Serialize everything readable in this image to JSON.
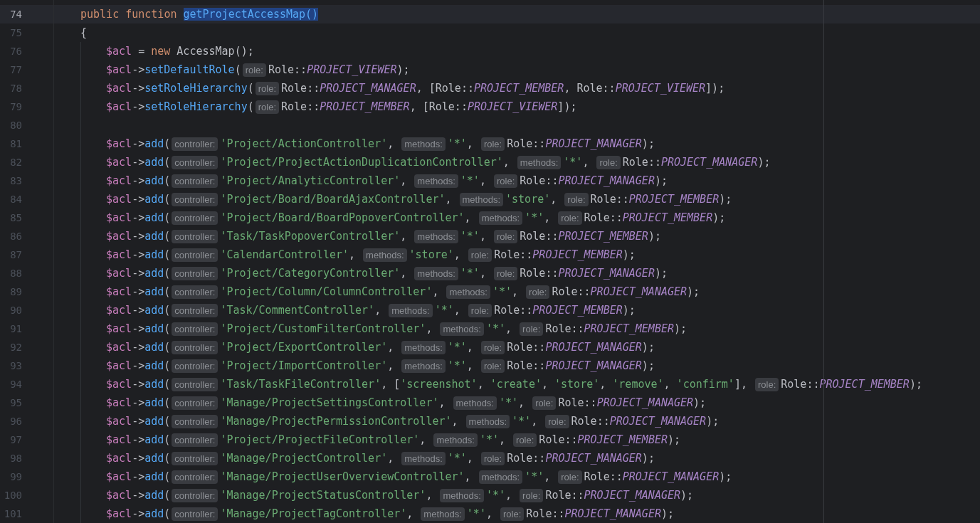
{
  "editor": {
    "lines": [
      {
        "number": "74",
        "current": true,
        "in_body": false,
        "tokens": [
          {
            "kind": "kw",
            "text": "public function "
          },
          {
            "kind": "sel",
            "text": "getProjectAccessMap()"
          }
        ]
      },
      {
        "number": "75",
        "current": false,
        "in_body": false,
        "tokens": [
          {
            "kind": "plain",
            "text": "{"
          }
        ]
      },
      {
        "number": "76",
        "current": false,
        "in_body": true,
        "tokens": [
          {
            "kind": "var",
            "text": "$acl"
          },
          {
            "kind": "plain",
            "text": " = "
          },
          {
            "kind": "kw",
            "text": "new "
          },
          {
            "kind": "cls",
            "text": "AccessMap"
          },
          {
            "kind": "plain",
            "text": "();"
          }
        ]
      },
      {
        "number": "77",
        "current": false,
        "in_body": true,
        "tokens": [
          {
            "kind": "var",
            "text": "$acl"
          },
          {
            "kind": "plain",
            "text": "->"
          },
          {
            "kind": "fn",
            "text": "setDefaultRole"
          },
          {
            "kind": "plain",
            "text": "("
          },
          {
            "kind": "hint",
            "text": "role:"
          },
          {
            "kind": "cls",
            "text": "Role"
          },
          {
            "kind": "plain",
            "text": "::"
          },
          {
            "kind": "const",
            "text": "PROJECT_VIEWER"
          },
          {
            "kind": "plain",
            "text": ");"
          }
        ]
      },
      {
        "number": "78",
        "current": false,
        "in_body": true,
        "tokens": [
          {
            "kind": "var",
            "text": "$acl"
          },
          {
            "kind": "plain",
            "text": "->"
          },
          {
            "kind": "fn",
            "text": "setRoleHierarchy"
          },
          {
            "kind": "plain",
            "text": "("
          },
          {
            "kind": "hint",
            "text": "role:"
          },
          {
            "kind": "cls",
            "text": "Role"
          },
          {
            "kind": "plain",
            "text": "::"
          },
          {
            "kind": "const",
            "text": "PROJECT_MANAGER"
          },
          {
            "kind": "plain",
            "text": ", ["
          },
          {
            "kind": "cls",
            "text": "Role"
          },
          {
            "kind": "plain",
            "text": "::"
          },
          {
            "kind": "const",
            "text": "PROJECT_MEMBER"
          },
          {
            "kind": "plain",
            "text": ", "
          },
          {
            "kind": "cls",
            "text": "Role"
          },
          {
            "kind": "plain",
            "text": "::"
          },
          {
            "kind": "const",
            "text": "PROJECT_VIEWER"
          },
          {
            "kind": "plain",
            "text": "]);"
          }
        ]
      },
      {
        "number": "79",
        "current": false,
        "in_body": true,
        "tokens": [
          {
            "kind": "var",
            "text": "$acl"
          },
          {
            "kind": "plain",
            "text": "->"
          },
          {
            "kind": "fn",
            "text": "setRoleHierarchy"
          },
          {
            "kind": "plain",
            "text": "("
          },
          {
            "kind": "hint",
            "text": "role:"
          },
          {
            "kind": "cls",
            "text": "Role"
          },
          {
            "kind": "plain",
            "text": "::"
          },
          {
            "kind": "const",
            "text": "PROJECT_MEMBER"
          },
          {
            "kind": "plain",
            "text": ", ["
          },
          {
            "kind": "cls",
            "text": "Role"
          },
          {
            "kind": "plain",
            "text": "::"
          },
          {
            "kind": "const",
            "text": "PROJECT_VIEWER"
          },
          {
            "kind": "plain",
            "text": "]);"
          }
        ]
      },
      {
        "number": "80",
        "current": false,
        "in_body": true
      },
      {
        "number": "81",
        "current": false,
        "in_body": true,
        "tokens": [
          {
            "kind": "var",
            "text": "$acl"
          },
          {
            "kind": "plain",
            "text": "->"
          },
          {
            "kind": "fn",
            "text": "add"
          },
          {
            "kind": "plain",
            "text": "("
          },
          {
            "kind": "hint",
            "text": "controller:"
          },
          {
            "kind": "str",
            "text": "'Project/ActionController'"
          },
          {
            "kind": "plain",
            "text": ", "
          },
          {
            "kind": "hint",
            "text": "methods:"
          },
          {
            "kind": "str",
            "text": "'*'"
          },
          {
            "kind": "plain",
            "text": ", "
          },
          {
            "kind": "hint",
            "text": "role:"
          },
          {
            "kind": "cls",
            "text": "Role"
          },
          {
            "kind": "plain",
            "text": "::"
          },
          {
            "kind": "const",
            "text": "PROJECT_MANAGER"
          },
          {
            "kind": "plain",
            "text": ");"
          }
        ]
      },
      {
        "number": "82",
        "current": false,
        "in_body": true,
        "tokens": [
          {
            "kind": "var",
            "text": "$acl"
          },
          {
            "kind": "plain",
            "text": "->"
          },
          {
            "kind": "fn",
            "text": "add"
          },
          {
            "kind": "plain",
            "text": "("
          },
          {
            "kind": "hint",
            "text": "controller:"
          },
          {
            "kind": "str",
            "text": "'Project/ProjectActionDuplicationController'"
          },
          {
            "kind": "plain",
            "text": ", "
          },
          {
            "kind": "hint",
            "text": "methods:"
          },
          {
            "kind": "str",
            "text": "'*'"
          },
          {
            "kind": "plain",
            "text": ", "
          },
          {
            "kind": "hint",
            "text": "role:"
          },
          {
            "kind": "cls",
            "text": "Role"
          },
          {
            "kind": "plain",
            "text": "::"
          },
          {
            "kind": "const",
            "text": "PROJECT_MANAGER"
          },
          {
            "kind": "plain",
            "text": ");"
          }
        ]
      },
      {
        "number": "83",
        "current": false,
        "in_body": true,
        "tokens": [
          {
            "kind": "var",
            "text": "$acl"
          },
          {
            "kind": "plain",
            "text": "->"
          },
          {
            "kind": "fn",
            "text": "add"
          },
          {
            "kind": "plain",
            "text": "("
          },
          {
            "kind": "hint",
            "text": "controller:"
          },
          {
            "kind": "str",
            "text": "'Project/AnalyticController'"
          },
          {
            "kind": "plain",
            "text": ", "
          },
          {
            "kind": "hint",
            "text": "methods:"
          },
          {
            "kind": "str",
            "text": "'*'"
          },
          {
            "kind": "plain",
            "text": ", "
          },
          {
            "kind": "hint",
            "text": "role:"
          },
          {
            "kind": "cls",
            "text": "Role"
          },
          {
            "kind": "plain",
            "text": "::"
          },
          {
            "kind": "const",
            "text": "PROJECT_MANAGER"
          },
          {
            "kind": "plain",
            "text": ");"
          }
        ]
      },
      {
        "number": "84",
        "current": false,
        "in_body": true,
        "tokens": [
          {
            "kind": "var",
            "text": "$acl"
          },
          {
            "kind": "plain",
            "text": "->"
          },
          {
            "kind": "fn",
            "text": "add"
          },
          {
            "kind": "plain",
            "text": "("
          },
          {
            "kind": "hint",
            "text": "controller:"
          },
          {
            "kind": "str",
            "text": "'Project/Board/BoardAjaxController'"
          },
          {
            "kind": "plain",
            "text": ", "
          },
          {
            "kind": "hint",
            "text": "methods:"
          },
          {
            "kind": "str",
            "text": "'store'"
          },
          {
            "kind": "plain",
            "text": ", "
          },
          {
            "kind": "hint",
            "text": "role:"
          },
          {
            "kind": "cls",
            "text": "Role"
          },
          {
            "kind": "plain",
            "text": "::"
          },
          {
            "kind": "const",
            "text": "PROJECT_MEMBER"
          },
          {
            "kind": "plain",
            "text": ");"
          }
        ]
      },
      {
        "number": "85",
        "current": false,
        "in_body": true,
        "tokens": [
          {
            "kind": "var",
            "text": "$acl"
          },
          {
            "kind": "plain",
            "text": "->"
          },
          {
            "kind": "fn",
            "text": "add"
          },
          {
            "kind": "plain",
            "text": "("
          },
          {
            "kind": "hint",
            "text": "controller:"
          },
          {
            "kind": "str",
            "text": "'Project/Board/BoardPopoverController'"
          },
          {
            "kind": "plain",
            "text": ", "
          },
          {
            "kind": "hint",
            "text": "methods:"
          },
          {
            "kind": "str",
            "text": "'*'"
          },
          {
            "kind": "plain",
            "text": ", "
          },
          {
            "kind": "hint",
            "text": "role:"
          },
          {
            "kind": "cls",
            "text": "Role"
          },
          {
            "kind": "plain",
            "text": "::"
          },
          {
            "kind": "const",
            "text": "PROJECT_MEMBER"
          },
          {
            "kind": "plain",
            "text": ");"
          }
        ]
      },
      {
        "number": "86",
        "current": false,
        "in_body": true,
        "tokens": [
          {
            "kind": "var",
            "text": "$acl"
          },
          {
            "kind": "plain",
            "text": "->"
          },
          {
            "kind": "fn",
            "text": "add"
          },
          {
            "kind": "plain",
            "text": "("
          },
          {
            "kind": "hint",
            "text": "controller:"
          },
          {
            "kind": "str",
            "text": "'Task/TaskPopoverController'"
          },
          {
            "kind": "plain",
            "text": ", "
          },
          {
            "kind": "hint",
            "text": "methods:"
          },
          {
            "kind": "str",
            "text": "'*'"
          },
          {
            "kind": "plain",
            "text": ", "
          },
          {
            "kind": "hint",
            "text": "role:"
          },
          {
            "kind": "cls",
            "text": "Role"
          },
          {
            "kind": "plain",
            "text": "::"
          },
          {
            "kind": "const",
            "text": "PROJECT_MEMBER"
          },
          {
            "kind": "plain",
            "text": ");"
          }
        ]
      },
      {
        "number": "87",
        "current": false,
        "in_body": true,
        "tokens": [
          {
            "kind": "var",
            "text": "$acl"
          },
          {
            "kind": "plain",
            "text": "->"
          },
          {
            "kind": "fn",
            "text": "add"
          },
          {
            "kind": "plain",
            "text": "("
          },
          {
            "kind": "hint",
            "text": "controller:"
          },
          {
            "kind": "str",
            "text": "'CalendarController'"
          },
          {
            "kind": "plain",
            "text": ", "
          },
          {
            "kind": "hint",
            "text": "methods:"
          },
          {
            "kind": "str",
            "text": "'store'"
          },
          {
            "kind": "plain",
            "text": ", "
          },
          {
            "kind": "hint",
            "text": "role:"
          },
          {
            "kind": "cls",
            "text": "Role"
          },
          {
            "kind": "plain",
            "text": "::"
          },
          {
            "kind": "const",
            "text": "PROJECT_MEMBER"
          },
          {
            "kind": "plain",
            "text": ");"
          }
        ]
      },
      {
        "number": "88",
        "current": false,
        "in_body": true,
        "tokens": [
          {
            "kind": "var",
            "text": "$acl"
          },
          {
            "kind": "plain",
            "text": "->"
          },
          {
            "kind": "fn",
            "text": "add"
          },
          {
            "kind": "plain",
            "text": "("
          },
          {
            "kind": "hint",
            "text": "controller:"
          },
          {
            "kind": "str",
            "text": "'Project/CategoryController'"
          },
          {
            "kind": "plain",
            "text": ", "
          },
          {
            "kind": "hint",
            "text": "methods:"
          },
          {
            "kind": "str",
            "text": "'*'"
          },
          {
            "kind": "plain",
            "text": ", "
          },
          {
            "kind": "hint",
            "text": "role:"
          },
          {
            "kind": "cls",
            "text": "Role"
          },
          {
            "kind": "plain",
            "text": "::"
          },
          {
            "kind": "const",
            "text": "PROJECT_MANAGER"
          },
          {
            "kind": "plain",
            "text": ");"
          }
        ]
      },
      {
        "number": "89",
        "current": false,
        "in_body": true,
        "tokens": [
          {
            "kind": "var",
            "text": "$acl"
          },
          {
            "kind": "plain",
            "text": "->"
          },
          {
            "kind": "fn",
            "text": "add"
          },
          {
            "kind": "plain",
            "text": "("
          },
          {
            "kind": "hint",
            "text": "controller:"
          },
          {
            "kind": "str",
            "text": "'Project/Column/ColumnController'"
          },
          {
            "kind": "plain",
            "text": ", "
          },
          {
            "kind": "hint",
            "text": "methods:"
          },
          {
            "kind": "str",
            "text": "'*'"
          },
          {
            "kind": "plain",
            "text": ", "
          },
          {
            "kind": "hint",
            "text": "role:"
          },
          {
            "kind": "cls",
            "text": "Role"
          },
          {
            "kind": "plain",
            "text": "::"
          },
          {
            "kind": "const",
            "text": "PROJECT_MANAGER"
          },
          {
            "kind": "plain",
            "text": ");"
          }
        ]
      },
      {
        "number": "90",
        "current": false,
        "in_body": true,
        "tokens": [
          {
            "kind": "var",
            "text": "$acl"
          },
          {
            "kind": "plain",
            "text": "->"
          },
          {
            "kind": "fn",
            "text": "add"
          },
          {
            "kind": "plain",
            "text": "("
          },
          {
            "kind": "hint",
            "text": "controller:"
          },
          {
            "kind": "str",
            "text": "'Task/CommentController'"
          },
          {
            "kind": "plain",
            "text": ", "
          },
          {
            "kind": "hint",
            "text": "methods:"
          },
          {
            "kind": "str",
            "text": "'*'"
          },
          {
            "kind": "plain",
            "text": ", "
          },
          {
            "kind": "hint",
            "text": "role:"
          },
          {
            "kind": "cls",
            "text": "Role"
          },
          {
            "kind": "plain",
            "text": "::"
          },
          {
            "kind": "const",
            "text": "PROJECT_MEMBER"
          },
          {
            "kind": "plain",
            "text": ");"
          }
        ]
      },
      {
        "number": "91",
        "current": false,
        "in_body": true,
        "tokens": [
          {
            "kind": "var",
            "text": "$acl"
          },
          {
            "kind": "plain",
            "text": "->"
          },
          {
            "kind": "fn",
            "text": "add"
          },
          {
            "kind": "plain",
            "text": "("
          },
          {
            "kind": "hint",
            "text": "controller:"
          },
          {
            "kind": "str",
            "text": "'Project/CustomFilterController'"
          },
          {
            "kind": "plain",
            "text": ", "
          },
          {
            "kind": "hint",
            "text": "methods:"
          },
          {
            "kind": "str",
            "text": "'*'"
          },
          {
            "kind": "plain",
            "text": ", "
          },
          {
            "kind": "hint",
            "text": "role:"
          },
          {
            "kind": "cls",
            "text": "Role"
          },
          {
            "kind": "plain",
            "text": "::"
          },
          {
            "kind": "const",
            "text": "PROJECT_MEMBER"
          },
          {
            "kind": "plain",
            "text": ");"
          }
        ]
      },
      {
        "number": "92",
        "current": false,
        "in_body": true,
        "tokens": [
          {
            "kind": "var",
            "text": "$acl"
          },
          {
            "kind": "plain",
            "text": "->"
          },
          {
            "kind": "fn",
            "text": "add"
          },
          {
            "kind": "plain",
            "text": "("
          },
          {
            "kind": "hint",
            "text": "controller:"
          },
          {
            "kind": "str",
            "text": "'Project/ExportController'"
          },
          {
            "kind": "plain",
            "text": ", "
          },
          {
            "kind": "hint",
            "text": "methods:"
          },
          {
            "kind": "str",
            "text": "'*'"
          },
          {
            "kind": "plain",
            "text": ", "
          },
          {
            "kind": "hint",
            "text": "role:"
          },
          {
            "kind": "cls",
            "text": "Role"
          },
          {
            "kind": "plain",
            "text": "::"
          },
          {
            "kind": "const",
            "text": "PROJECT_MANAGER"
          },
          {
            "kind": "plain",
            "text": ");"
          }
        ]
      },
      {
        "number": "93",
        "current": false,
        "in_body": true,
        "tokens": [
          {
            "kind": "var",
            "text": "$acl"
          },
          {
            "kind": "plain",
            "text": "->"
          },
          {
            "kind": "fn",
            "text": "add"
          },
          {
            "kind": "plain",
            "text": "("
          },
          {
            "kind": "hint",
            "text": "controller:"
          },
          {
            "kind": "str",
            "text": "'Project/ImportController'"
          },
          {
            "kind": "plain",
            "text": ", "
          },
          {
            "kind": "hint",
            "text": "methods:"
          },
          {
            "kind": "str",
            "text": "'*'"
          },
          {
            "kind": "plain",
            "text": ", "
          },
          {
            "kind": "hint",
            "text": "role:"
          },
          {
            "kind": "cls",
            "text": "Role"
          },
          {
            "kind": "plain",
            "text": "::"
          },
          {
            "kind": "const",
            "text": "PROJECT_MANAGER"
          },
          {
            "kind": "plain",
            "text": ");"
          }
        ]
      },
      {
        "number": "94",
        "current": false,
        "in_body": true,
        "tokens": [
          {
            "kind": "var",
            "text": "$acl"
          },
          {
            "kind": "plain",
            "text": "->"
          },
          {
            "kind": "fn",
            "text": "add"
          },
          {
            "kind": "plain",
            "text": "("
          },
          {
            "kind": "hint",
            "text": "controller:"
          },
          {
            "kind": "str",
            "text": "'Task/TaskFileController'"
          },
          {
            "kind": "plain",
            "text": ", ["
          },
          {
            "kind": "str",
            "text": "'screenshot'"
          },
          {
            "kind": "plain",
            "text": ", "
          },
          {
            "kind": "str",
            "text": "'create'"
          },
          {
            "kind": "plain",
            "text": ", "
          },
          {
            "kind": "str",
            "text": "'store'"
          },
          {
            "kind": "plain",
            "text": ", "
          },
          {
            "kind": "str",
            "text": "'remove'"
          },
          {
            "kind": "plain",
            "text": ", "
          },
          {
            "kind": "str",
            "text": "'confirm'"
          },
          {
            "kind": "plain",
            "text": "], "
          },
          {
            "kind": "hint",
            "text": "role:"
          },
          {
            "kind": "cls",
            "text": "Role"
          },
          {
            "kind": "plain",
            "text": "::"
          },
          {
            "kind": "const",
            "text": "PROJECT_MEMBER"
          },
          {
            "kind": "plain",
            "text": ");"
          }
        ]
      },
      {
        "number": "95",
        "current": false,
        "in_body": true,
        "tokens": [
          {
            "kind": "var",
            "text": "$acl"
          },
          {
            "kind": "plain",
            "text": "->"
          },
          {
            "kind": "fn",
            "text": "add"
          },
          {
            "kind": "plain",
            "text": "("
          },
          {
            "kind": "hint",
            "text": "controller:"
          },
          {
            "kind": "str",
            "text": "'Manage/ProjectSettingsController'"
          },
          {
            "kind": "plain",
            "text": ", "
          },
          {
            "kind": "hint",
            "text": "methods:"
          },
          {
            "kind": "str",
            "text": "'*'"
          },
          {
            "kind": "plain",
            "text": ", "
          },
          {
            "kind": "hint",
            "text": "role:"
          },
          {
            "kind": "cls",
            "text": "Role"
          },
          {
            "kind": "plain",
            "text": "::"
          },
          {
            "kind": "const",
            "text": "PROJECT_MANAGER"
          },
          {
            "kind": "plain",
            "text": ");"
          }
        ]
      },
      {
        "number": "96",
        "current": false,
        "in_body": true,
        "tokens": [
          {
            "kind": "var",
            "text": "$acl"
          },
          {
            "kind": "plain",
            "text": "->"
          },
          {
            "kind": "fn",
            "text": "add"
          },
          {
            "kind": "plain",
            "text": "("
          },
          {
            "kind": "hint",
            "text": "controller:"
          },
          {
            "kind": "str",
            "text": "'Manage/ProjectPermissionController'"
          },
          {
            "kind": "plain",
            "text": ", "
          },
          {
            "kind": "hint",
            "text": "methods:"
          },
          {
            "kind": "str",
            "text": "'*'"
          },
          {
            "kind": "plain",
            "text": ", "
          },
          {
            "kind": "hint",
            "text": "role:"
          },
          {
            "kind": "cls",
            "text": "Role"
          },
          {
            "kind": "plain",
            "text": "::"
          },
          {
            "kind": "const",
            "text": "PROJECT_MANAGER"
          },
          {
            "kind": "plain",
            "text": ");"
          }
        ]
      },
      {
        "number": "97",
        "current": false,
        "in_body": true,
        "tokens": [
          {
            "kind": "var",
            "text": "$acl"
          },
          {
            "kind": "plain",
            "text": "->"
          },
          {
            "kind": "fn",
            "text": "add"
          },
          {
            "kind": "plain",
            "text": "("
          },
          {
            "kind": "hint",
            "text": "controller:"
          },
          {
            "kind": "str",
            "text": "'Project/ProjectFileController'"
          },
          {
            "kind": "plain",
            "text": ", "
          },
          {
            "kind": "hint",
            "text": "methods:"
          },
          {
            "kind": "str",
            "text": "'*'"
          },
          {
            "kind": "plain",
            "text": ", "
          },
          {
            "kind": "hint",
            "text": "role:"
          },
          {
            "kind": "cls",
            "text": "Role"
          },
          {
            "kind": "plain",
            "text": "::"
          },
          {
            "kind": "const",
            "text": "PROJECT_MEMBER"
          },
          {
            "kind": "plain",
            "text": ");"
          }
        ]
      },
      {
        "number": "98",
        "current": false,
        "in_body": true,
        "tokens": [
          {
            "kind": "var",
            "text": "$acl"
          },
          {
            "kind": "plain",
            "text": "->"
          },
          {
            "kind": "fn",
            "text": "add"
          },
          {
            "kind": "plain",
            "text": "("
          },
          {
            "kind": "hint",
            "text": "controller:"
          },
          {
            "kind": "str",
            "text": "'Manage/ProjectController'"
          },
          {
            "kind": "plain",
            "text": ", "
          },
          {
            "kind": "hint",
            "text": "methods:"
          },
          {
            "kind": "str",
            "text": "'*'"
          },
          {
            "kind": "plain",
            "text": ", "
          },
          {
            "kind": "hint",
            "text": "role:"
          },
          {
            "kind": "cls",
            "text": "Role"
          },
          {
            "kind": "plain",
            "text": "::"
          },
          {
            "kind": "const",
            "text": "PROJECT_MANAGER"
          },
          {
            "kind": "plain",
            "text": ");"
          }
        ]
      },
      {
        "number": "99",
        "current": false,
        "in_body": true,
        "tokens": [
          {
            "kind": "var",
            "text": "$acl"
          },
          {
            "kind": "plain",
            "text": "->"
          },
          {
            "kind": "fn",
            "text": "add"
          },
          {
            "kind": "plain",
            "text": "("
          },
          {
            "kind": "hint",
            "text": "controller:"
          },
          {
            "kind": "str",
            "text": "'Manage/ProjectUserOverviewController'"
          },
          {
            "kind": "plain",
            "text": ", "
          },
          {
            "kind": "hint",
            "text": "methods:"
          },
          {
            "kind": "str",
            "text": "'*'"
          },
          {
            "kind": "plain",
            "text": ", "
          },
          {
            "kind": "hint",
            "text": "role:"
          },
          {
            "kind": "cls",
            "text": "Role"
          },
          {
            "kind": "plain",
            "text": "::"
          },
          {
            "kind": "const",
            "text": "PROJECT_MANAGER"
          },
          {
            "kind": "plain",
            "text": ");"
          }
        ]
      },
      {
        "number": "100",
        "current": false,
        "in_body": true,
        "tokens": [
          {
            "kind": "var",
            "text": "$acl"
          },
          {
            "kind": "plain",
            "text": "->"
          },
          {
            "kind": "fn",
            "text": "add"
          },
          {
            "kind": "plain",
            "text": "("
          },
          {
            "kind": "hint",
            "text": "controller:"
          },
          {
            "kind": "str",
            "text": "'Manage/ProjectStatusController'"
          },
          {
            "kind": "plain",
            "text": ", "
          },
          {
            "kind": "hint",
            "text": "methods:"
          },
          {
            "kind": "str",
            "text": "'*'"
          },
          {
            "kind": "plain",
            "text": ", "
          },
          {
            "kind": "hint",
            "text": "role:"
          },
          {
            "kind": "cls",
            "text": "Role"
          },
          {
            "kind": "plain",
            "text": "::"
          },
          {
            "kind": "const",
            "text": "PROJECT_MANAGER"
          },
          {
            "kind": "plain",
            "text": ");"
          }
        ]
      },
      {
        "number": "101",
        "current": false,
        "in_body": true,
        "tokens": [
          {
            "kind": "var",
            "text": "$acl"
          },
          {
            "kind": "plain",
            "text": "->"
          },
          {
            "kind": "fn",
            "text": "add"
          },
          {
            "kind": "plain",
            "text": "("
          },
          {
            "kind": "hint",
            "text": "controller:"
          },
          {
            "kind": "str",
            "text": "'Manage/ProjectTagController'"
          },
          {
            "kind": "plain",
            "text": ", "
          },
          {
            "kind": "hint",
            "text": "methods:"
          },
          {
            "kind": "str",
            "text": "'*'"
          },
          {
            "kind": "plain",
            "text": ", "
          },
          {
            "kind": "hint",
            "text": "role:"
          },
          {
            "kind": "cls",
            "text": "Role"
          },
          {
            "kind": "plain",
            "text": "::"
          },
          {
            "kind": "const",
            "text": "PROJECT_MANAGER"
          },
          {
            "kind": "plain",
            "text": ");"
          }
        ]
      }
    ]
  }
}
